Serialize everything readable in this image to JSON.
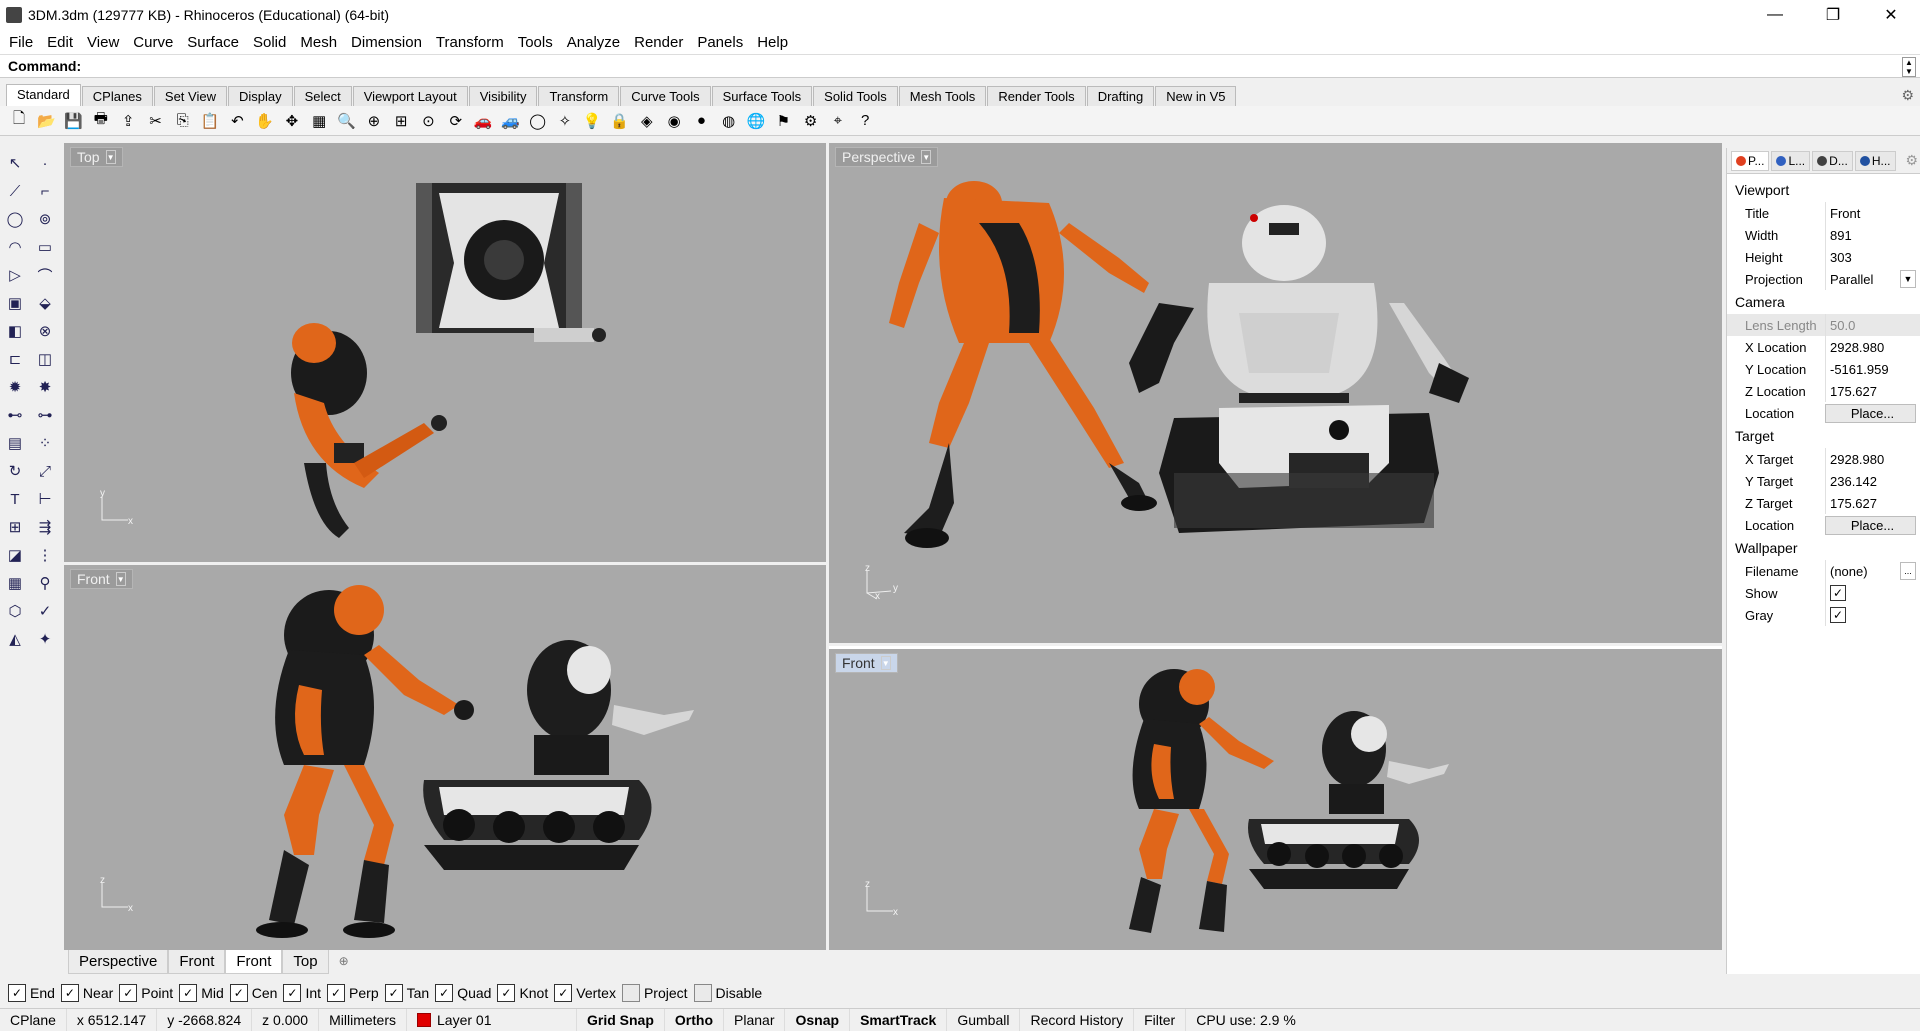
{
  "window": {
    "title": "3DM.3dm (129777 KB) - Rhinoceros (Educational) (64-bit)",
    "minimize": "—",
    "restore": "❐",
    "close": "✕"
  },
  "menu": [
    "File",
    "Edit",
    "View",
    "Curve",
    "Surface",
    "Solid",
    "Mesh",
    "Dimension",
    "Transform",
    "Tools",
    "Analyze",
    "Render",
    "Panels",
    "Help"
  ],
  "command": {
    "label": "Command:",
    "value": ""
  },
  "toolbar_tabs": [
    "Standard",
    "CPlanes",
    "Set View",
    "Display",
    "Select",
    "Viewport Layout",
    "Visibility",
    "Transform",
    "Curve Tools",
    "Surface Tools",
    "Solid Tools",
    "Mesh Tools",
    "Render Tools",
    "Drafting",
    "New in V5"
  ],
  "toolbar_icons": [
    "new-icon",
    "open-icon",
    "save-icon",
    "print-icon",
    "import-icon",
    "cut-icon",
    "copy-icon",
    "paste-icon",
    "undo-icon",
    "pan-hand-icon",
    "move-view-icon",
    "grid-icon",
    "zoom-icon",
    "zoom-window-icon",
    "zoom-extents-icon",
    "zoom-selected-icon",
    "rotate-view-icon",
    "car-icon",
    "car2-icon",
    "circle-icon",
    "light-icon",
    "bulb-icon",
    "lock-icon",
    "shade-icon",
    "color-wheel-icon",
    "sphere-icon",
    "metal-sphere-icon",
    "render-sphere-icon",
    "filter-icon",
    "gear-settings-icon",
    "snap-icon",
    "help-icon"
  ],
  "toolbar_glyphs": [
    "🗋",
    "📂",
    "💾",
    "🖶",
    "⇪",
    "✂",
    "⎘",
    "📋",
    "↶",
    "✋",
    "✥",
    "▦",
    "🔍",
    "⊕",
    "⊞",
    "⊙",
    "⟳",
    "🚗",
    "🚙",
    "◯",
    "✧",
    "💡",
    "🔒",
    "◈",
    "◉",
    "●",
    "◍",
    "🌐",
    "⚑",
    "⚙",
    "⌖",
    "?"
  ],
  "left_tools": [
    "select-arrow-icon",
    "point-icon",
    "polyline-icon",
    "curve-edit-icon",
    "circle-tool-icon",
    "ellipse-icon",
    "arc-icon",
    "rectangle-icon",
    "polygon-icon",
    "fillet-icon",
    "surface-icon",
    "extrude-icon",
    "box-icon",
    "boolean-icon",
    "cylinder-icon",
    "pipe-icon",
    "gear-tool-icon",
    "explode-icon",
    "split-icon",
    "trim-icon",
    "mesh-tool-icon",
    "dots-icon",
    "rotate-icon",
    "scale-icon",
    "text-icon",
    "dimension-icon",
    "array-icon",
    "align-icon",
    "layer-box-icon",
    "grid-tool-icon",
    "matrix-icon",
    "measure-icon",
    "cage-icon",
    "check-icon",
    "render-tool-icon",
    "light-tool-icon"
  ],
  "left_glyphs": [
    "↖",
    "·",
    "⟋",
    "⌐",
    "◯",
    "⊚",
    "◠",
    "▭",
    "▷",
    "⌒",
    "▣",
    "⬙",
    "◧",
    "⊗",
    "⊏",
    "◫",
    "✹",
    "✸",
    "⊷",
    "⊶",
    "▤",
    "⁘",
    "↻",
    "⤢",
    "T",
    "⊢",
    "⊞",
    "⇶",
    "◪",
    "⋮",
    "▦",
    "⚲",
    "⬡",
    "✓",
    "◭",
    "✦"
  ],
  "viewports": {
    "top": {
      "title": "Top",
      "axis_y": "y",
      "axis_x": "x"
    },
    "perspective": {
      "title": "Perspective",
      "axis_z": "z",
      "axis_x": "x",
      "axis_y": "y"
    },
    "front_left": {
      "title": "Front",
      "axis_z": "z",
      "axis_x": "x"
    },
    "front_right": {
      "title": "Front",
      "axis_z": "z",
      "axis_x": "x"
    }
  },
  "viewport_tabs": [
    "Perspective",
    "Front",
    "Front",
    "Top"
  ],
  "viewport_tabs_active": 2,
  "add_tab": "⊕",
  "panel": {
    "tabs": [
      {
        "label": "P...",
        "color": "#e04020"
      },
      {
        "label": "L...",
        "color": "#3060c0"
      },
      {
        "label": "D...",
        "color": "#404040"
      },
      {
        "label": "H...",
        "color": "#2050a0"
      }
    ],
    "sections": {
      "viewport": "Viewport",
      "camera": "Camera",
      "target": "Target",
      "wallpaper": "Wallpaper"
    },
    "viewport_rows": [
      {
        "k": "Title",
        "v": "Front"
      },
      {
        "k": "Width",
        "v": "891"
      },
      {
        "k": "Height",
        "v": "303"
      },
      {
        "k": "Projection",
        "v": "Parallel"
      }
    ],
    "camera_rows": [
      {
        "k": "Lens Length",
        "v": "50.0"
      },
      {
        "k": "X Location",
        "v": "2928.980"
      },
      {
        "k": "Y Location",
        "v": "-5161.959"
      },
      {
        "k": "Z Location",
        "v": "175.627"
      },
      {
        "k": "Location",
        "v": "Place..."
      }
    ],
    "target_rows": [
      {
        "k": "X Target",
        "v": "2928.980"
      },
      {
        "k": "Y Target",
        "v": "236.142"
      },
      {
        "k": "Z Target",
        "v": "175.627"
      },
      {
        "k": "Location",
        "v": "Place..."
      }
    ],
    "wallpaper_rows": [
      {
        "k": "Filename",
        "v": "(none)"
      },
      {
        "k": "Show",
        "v": "✓"
      },
      {
        "k": "Gray",
        "v": "✓"
      }
    ],
    "browse": "..."
  },
  "osnaps": [
    {
      "label": "End",
      "checked": true
    },
    {
      "label": "Near",
      "checked": true
    },
    {
      "label": "Point",
      "checked": true
    },
    {
      "label": "Mid",
      "checked": true
    },
    {
      "label": "Cen",
      "checked": true
    },
    {
      "label": "Int",
      "checked": true
    },
    {
      "label": "Perp",
      "checked": true
    },
    {
      "label": "Tan",
      "checked": true
    },
    {
      "label": "Quad",
      "checked": true
    },
    {
      "label": "Knot",
      "checked": true
    },
    {
      "label": "Vertex",
      "checked": true
    },
    {
      "label": "Project",
      "checked": false
    },
    {
      "label": "Disable",
      "checked": false
    }
  ],
  "status": {
    "cplane": "CPlane",
    "x": "x 6512.147",
    "y": "y -2668.824",
    "z": "z 0.000",
    "units": "Millimeters",
    "layer": "Layer 01",
    "layer_color": "#e00000",
    "grid_snap": "Grid Snap",
    "ortho": "Ortho",
    "planar": "Planar",
    "osnap": "Osnap",
    "smarttrack": "SmartTrack",
    "gumball": "Gumball",
    "record_history": "Record History",
    "filter": "Filter",
    "cpu": "CPU use: 2.9 %"
  },
  "colors": {
    "viewport_bg": "#a9a9a9",
    "robot_orange": "#e0661a",
    "robot_black": "#1c1c1c",
    "robot_white": "#e6e6e6"
  }
}
